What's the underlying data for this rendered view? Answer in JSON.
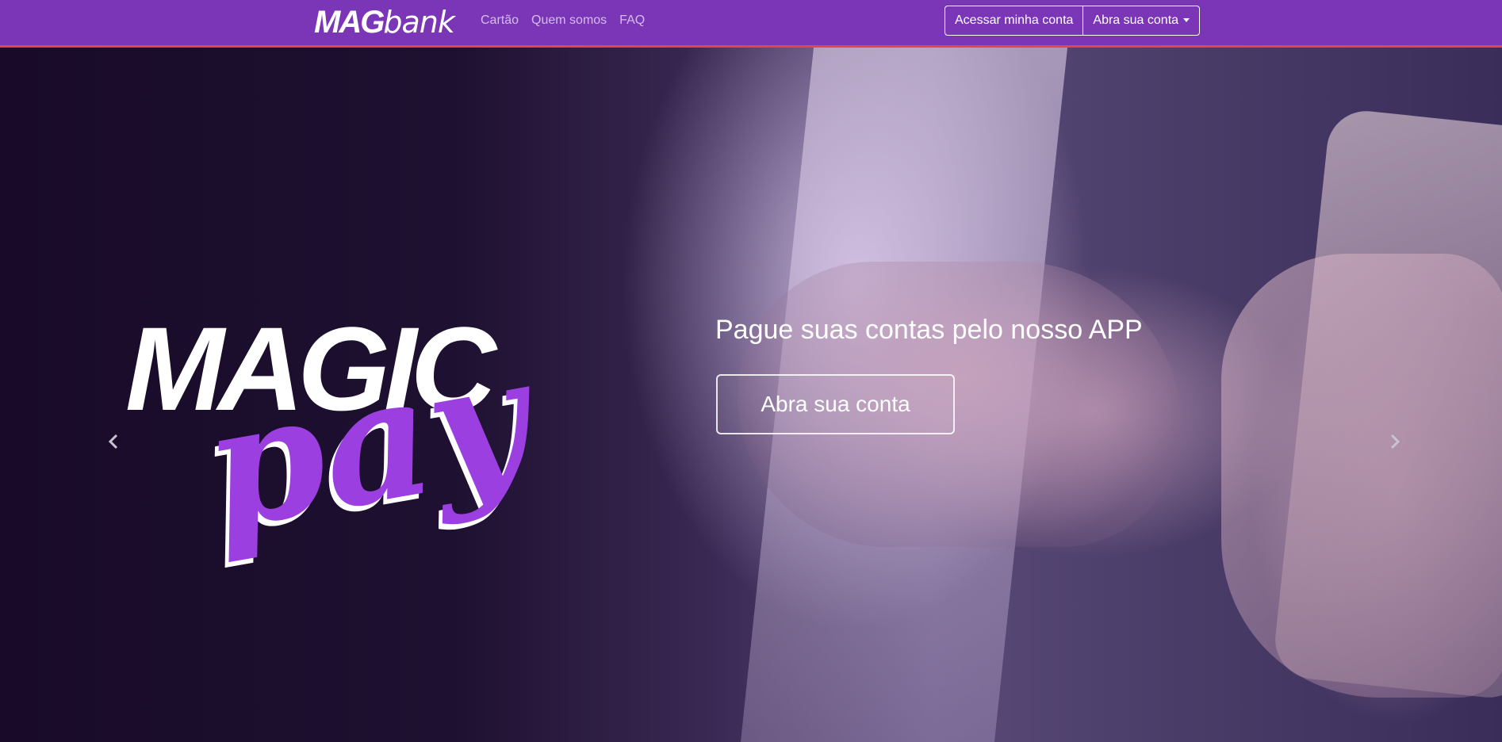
{
  "navbar": {
    "brand_mag": "MAG",
    "brand_bank": "bank",
    "links": [
      "Cartão",
      "Quem somos",
      "FAQ"
    ],
    "login_label": "Acessar minha conta",
    "open_account_label": "Abra sua conta"
  },
  "hero": {
    "logo_magic": "MAGIC",
    "logo_pay": "pay",
    "caption": "Pague suas contas pelo nosso APP",
    "cta_label": "Abra sua conta"
  },
  "icons": {
    "prev": "chevron-left-icon",
    "next": "chevron-right-icon",
    "dropdown": "caret-down-icon"
  },
  "colors": {
    "navbar": "#7b35b7",
    "navbar_border": "#e0474c",
    "accent_purple": "#9b3fe0"
  }
}
